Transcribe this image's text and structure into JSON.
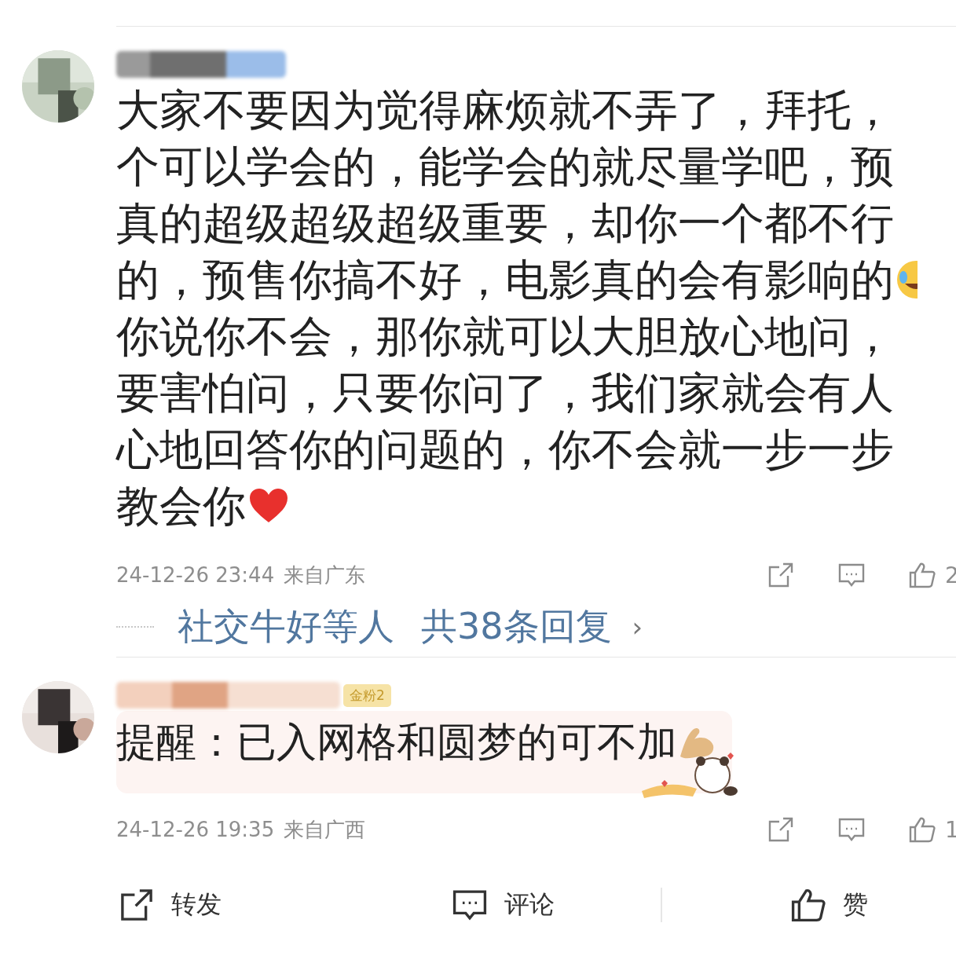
{
  "comments": [
    {
      "kind": "long",
      "lines": [
        "大家不要因为觉得麻烦就不弄了，拜托，",
        "个可以学会的，能学会的就尽量学吧，预",
        "真的超级超级超级重要，却你一个都不行",
        "的，预售你搞不好，电影真的会有影响的",
        "你说你不会，那你就可以大胆放心地问，",
        "要害怕问，只要你问了，我们家就会有人",
        "心地回答你的问题的，你不会就一步一步",
        "教会你"
      ],
      "time": "24-12-26 23:44",
      "location": "来自广东",
      "likes": "2",
      "replies": {
        "names": "社交牛好等人",
        "total": "共38条回复",
        "arrow": "›"
      }
    },
    {
      "kind": "highlight",
      "badge": "金粉2",
      "lines": [
        "提醒：已入网格和圆梦的可不加"
      ],
      "time": "24-12-26 19:35",
      "location": "来自广西",
      "likes": "1"
    }
  ],
  "bottom_bar": [
    {
      "label": "转发",
      "kind": "share"
    },
    {
      "label": "评论",
      "kind": "comment"
    },
    {
      "label": "赞",
      "kind": "like"
    }
  ]
}
